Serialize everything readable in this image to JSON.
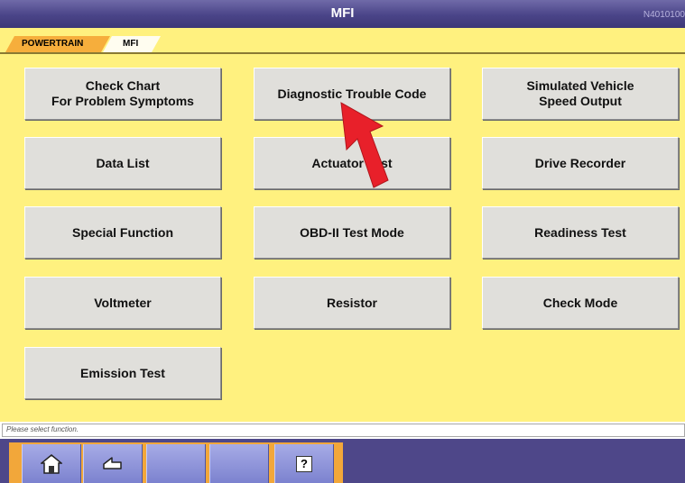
{
  "window": {
    "title": "MFI",
    "screen_id": "N4010100"
  },
  "breadcrumb": {
    "items": [
      "POWERTRAIN",
      "MFI"
    ]
  },
  "functions": [
    "Check Chart\nFor Problem Symptoms",
    "Diagnostic Trouble Code",
    "Simulated Vehicle\nSpeed Output",
    "Data List",
    "Actuator Test",
    "Drive Recorder",
    "Special Function",
    "OBD-II Test Mode",
    "Readiness Test",
    "Voltmeter",
    "Resistor",
    "Check Mode",
    "Emission Test"
  ],
  "status": {
    "text": "Please select function."
  },
  "toolbar": {
    "help_label": "?",
    "icons": [
      "home-icon",
      "back-arrow-icon",
      "help-icon"
    ]
  },
  "colors": {
    "title_bar": "#4a4488",
    "content_bg": "#fff17f",
    "button_bg": "#e0dfdb",
    "breadcrumb_active": "#f6ae3c",
    "toolbar_frame": "#f2a73a",
    "pointer_arrow": "#e8202a"
  }
}
